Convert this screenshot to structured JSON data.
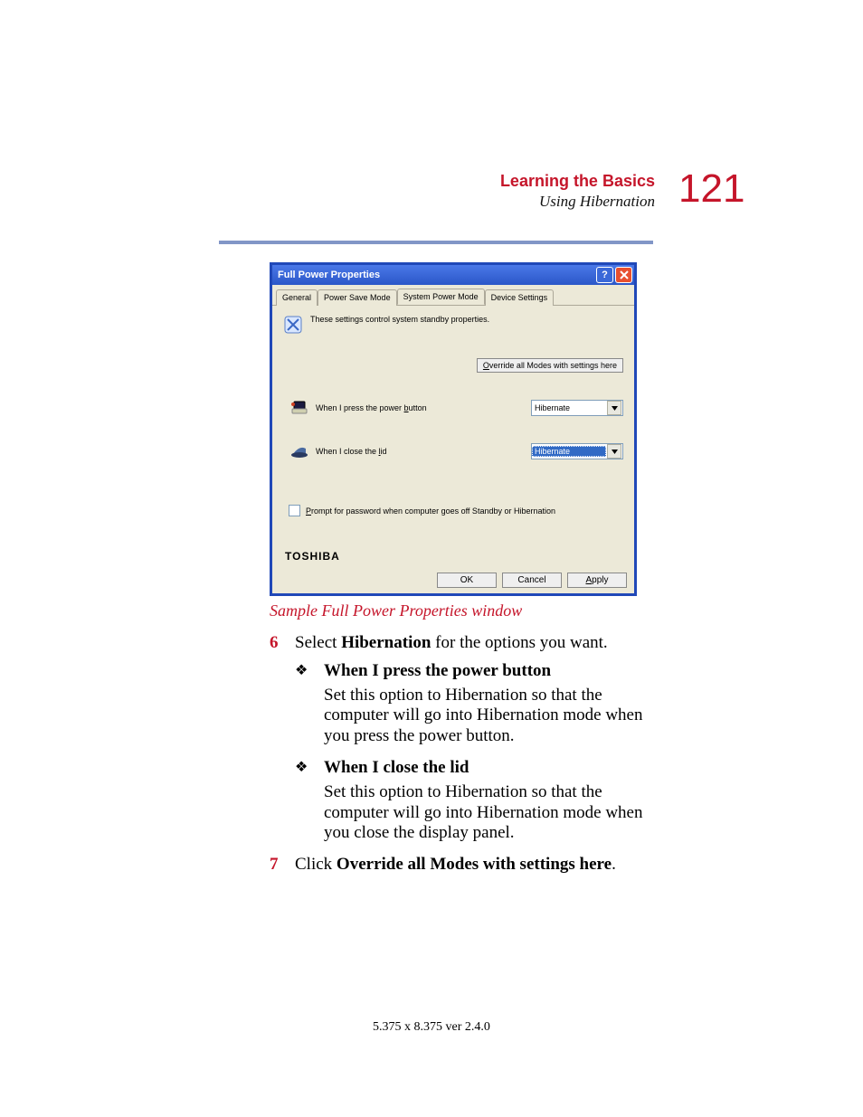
{
  "header": {
    "title": "Learning the Basics",
    "subtitle": "Using Hibernation",
    "page_number": "121"
  },
  "window": {
    "title": "Full Power Properties",
    "tabs": [
      "General",
      "Power Save Mode",
      "System Power Mode",
      "Device Settings"
    ],
    "active_tab_index": 2,
    "description": "These settings control system standby properties.",
    "override_button": "Override all Modes with settings here",
    "override_hotkey": "O",
    "setting1": {
      "label_pre": "When I press the power ",
      "label_hot": "b",
      "label_post": "utton",
      "value": "Hibernate"
    },
    "setting2": {
      "label_pre": "When I close the ",
      "label_hot": "l",
      "label_post": "id",
      "value": "Hibernate"
    },
    "checkbox": {
      "label_hot": "P",
      "label_post": "rompt for password when computer goes off Standby or Hibernation"
    },
    "brand": "TOSHIBA",
    "buttons": {
      "ok": "OK",
      "cancel": "Cancel",
      "apply_hot": "A",
      "apply_post": "pply"
    }
  },
  "caption": "Sample Full Power Properties window",
  "steps": {
    "s6_num": "6",
    "s6_pre": "Select ",
    "s6_bold": "Hibernation",
    "s6_post": " for the options you want.",
    "b1_title": "When I press the power button",
    "b1_desc": "Set this option to Hibernation so that the computer will go into Hibernation mode when you press the power button.",
    "b2_title": "When I close the lid",
    "b2_desc": "Set this option to Hibernation so that the computer will go into Hibernation mode when you close the display panel.",
    "s7_num": "7",
    "s7_pre": "Click ",
    "s7_bold": "Override all Modes with settings here",
    "s7_post": "."
  },
  "footer": "5.375 x 8.375 ver 2.4.0"
}
